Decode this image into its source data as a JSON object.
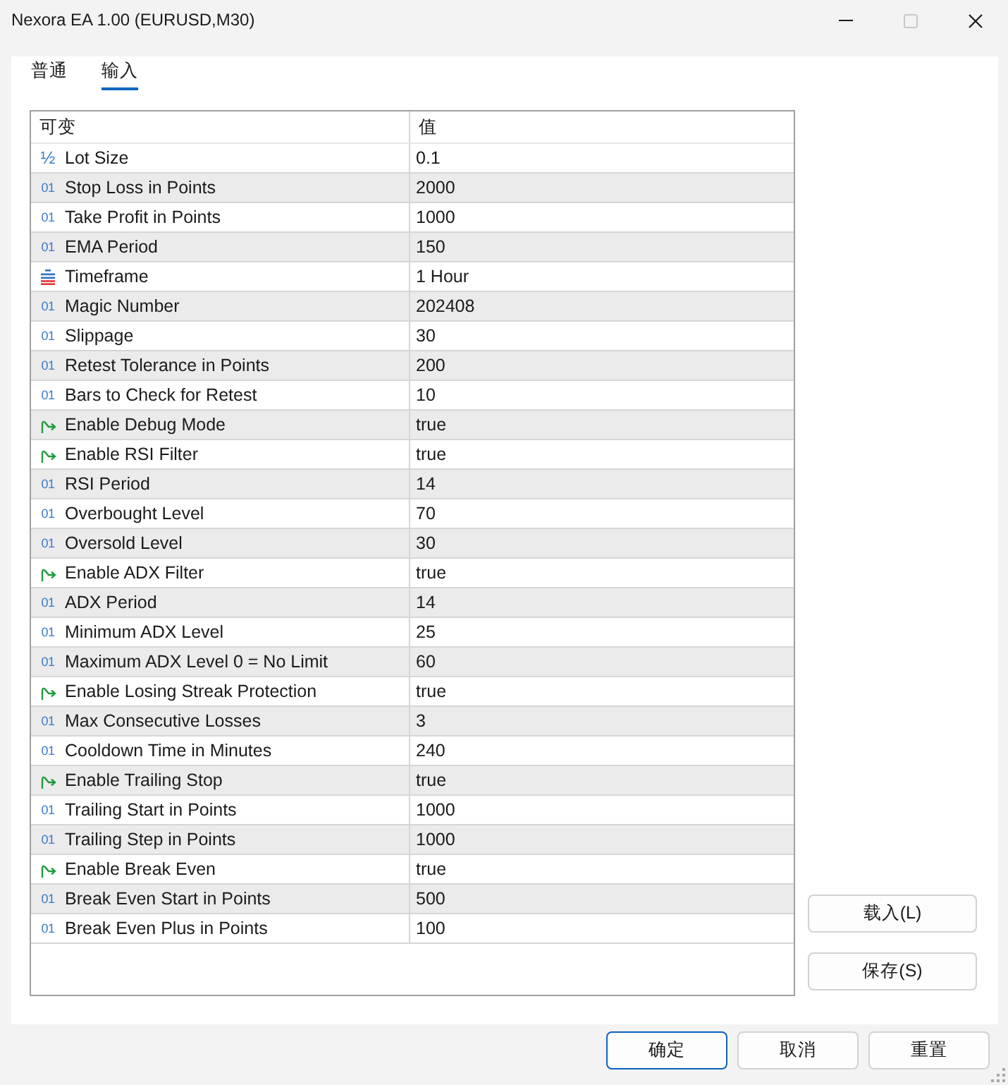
{
  "window": {
    "title": "Nexora EA 1.00 (EURUSD,M30)",
    "controls": [
      {
        "kind": "minimize",
        "disabled": false
      },
      {
        "kind": "maximize",
        "disabled": true
      },
      {
        "kind": "close",
        "disabled": false
      }
    ]
  },
  "tabs": [
    {
      "label": "普通",
      "selected": false
    },
    {
      "label": "输入",
      "selected": true
    }
  ],
  "table": {
    "columns": [
      "可变",
      "值"
    ],
    "rows": [
      {
        "kind": "double",
        "icon": "½",
        "name": "Lot Size",
        "value": "0.1"
      },
      {
        "kind": "int",
        "icon": "01",
        "name": "Stop Loss in Points",
        "value": "2000"
      },
      {
        "kind": "int",
        "icon": "01",
        "name": "Take Profit in Points",
        "value": "1000"
      },
      {
        "kind": "int",
        "icon": "01",
        "name": "EMA Period",
        "value": "150"
      },
      {
        "kind": "enum",
        "name": "Timeframe",
        "value": "1 Hour"
      },
      {
        "kind": "int",
        "icon": "01",
        "name": "Magic Number",
        "value": "202408"
      },
      {
        "kind": "int",
        "icon": "01",
        "name": "Slippage",
        "value": "30"
      },
      {
        "kind": "int",
        "icon": "01",
        "name": "Retest Tolerance in Points",
        "value": "200"
      },
      {
        "kind": "int",
        "icon": "01",
        "name": "Bars to Check for Retest",
        "value": "10"
      },
      {
        "kind": "bool",
        "name": "Enable Debug Mode",
        "value": "true"
      },
      {
        "kind": "bool",
        "name": "Enable RSI Filter",
        "value": "true"
      },
      {
        "kind": "int",
        "icon": "01",
        "name": "RSI Period",
        "value": "14"
      },
      {
        "kind": "int",
        "icon": "01",
        "name": "Overbought Level",
        "value": "70"
      },
      {
        "kind": "int",
        "icon": "01",
        "name": "Oversold Level",
        "value": "30"
      },
      {
        "kind": "bool",
        "name": "Enable ADX Filter",
        "value": "true"
      },
      {
        "kind": "int",
        "icon": "01",
        "name": "ADX Period",
        "value": "14"
      },
      {
        "kind": "int",
        "icon": "01",
        "name": "Minimum ADX Level",
        "value": "25"
      },
      {
        "kind": "int",
        "icon": "01",
        "name": "Maximum ADX Level 0 = No Limit",
        "value": "60"
      },
      {
        "kind": "bool",
        "name": "Enable Losing Streak Protection",
        "value": "true"
      },
      {
        "kind": "int",
        "icon": "01",
        "name": "Max Consecutive Losses",
        "value": "3"
      },
      {
        "kind": "int",
        "icon": "01",
        "name": "Cooldown Time in Minutes",
        "value": "240"
      },
      {
        "kind": "bool",
        "name": "Enable Trailing Stop",
        "value": "true"
      },
      {
        "kind": "int",
        "icon": "01",
        "name": "Trailing Start in Points",
        "value": "1000"
      },
      {
        "kind": "int",
        "icon": "01",
        "name": "Trailing Step in Points",
        "value": "1000"
      },
      {
        "kind": "bool",
        "name": "Enable Break Even",
        "value": "true"
      },
      {
        "kind": "int",
        "icon": "01",
        "name": "Break Even Start in Points",
        "value": "500"
      },
      {
        "kind": "int",
        "icon": "01",
        "name": "Break Even Plus in Points",
        "value": "100"
      }
    ]
  },
  "side_buttons": [
    "载入(L)",
    "保存(S)"
  ],
  "buttons": [
    {
      "label": "确定",
      "default": true
    },
    {
      "label": "取消",
      "default": false
    },
    {
      "label": "重置",
      "default": false
    }
  ]
}
